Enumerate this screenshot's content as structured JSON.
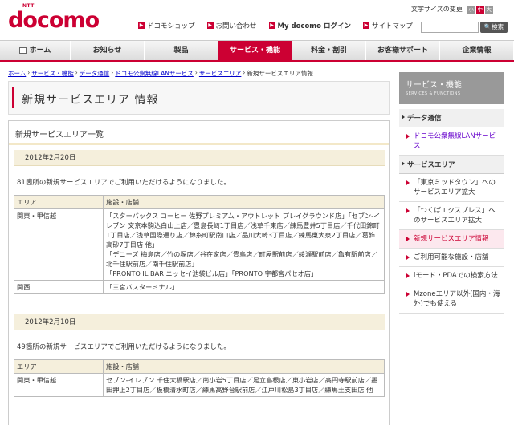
{
  "header": {
    "logo_ntt": "NTT",
    "logo_brand": "docomo",
    "links": [
      "ドコモショップ",
      "お問い合わせ",
      "My docomo ログイン",
      "サイトマップ"
    ],
    "fontsize_label": "文字サイズの変更",
    "fontsize_options": [
      "小",
      "中",
      "大"
    ],
    "search_button": "検索"
  },
  "gnav": [
    "ホーム",
    "お知らせ",
    "製品",
    "サービス・機能",
    "料金・割引",
    "お客様サポート",
    "企業情報"
  ],
  "breadcrumb": {
    "items": [
      "ホーム",
      "サービス・機能",
      "データ通信",
      "ドコモ公衆無線LANサービス",
      "サービスエリア"
    ],
    "current": "新規サービスエリア情報"
  },
  "page_title": "新規サービスエリア 情報",
  "main": {
    "heading": "新規サービスエリア一覧",
    "sections": [
      {
        "date": "2012年2月20日",
        "intro": "81箇所の新規サービスエリアでご利用いただけるようになりました。",
        "col_area": "エリア",
        "col_shops": "施設・店舗",
        "rows": [
          {
            "area": "関東・甲信越",
            "shops": [
              "「スターバックス コーヒー 佐野プレミアム・アウトレット プレイグラウンド店」「セブン-イレブン 文京本駒込白山上店／豊島長崎1丁目店／浅草千束店／練馬豊井5丁目店／千代田錦町1丁目店／浅草国際通り店／錦糸町駅南口店／品川大崎3丁目店／練馬東大泉2丁目店／葛飾高砂7丁目店 他」",
              "「デニーズ 梅島店／竹の塚店／谷在家店／豊島店／町屋駅前店／綾瀬駅前店／亀有駅前店／北千住駅前店／南千住駅前店」",
              "「PRONTO IL BAR ニッセイ池袋ビル店」「PRONTO 宇都宮パセオ店」"
            ]
          },
          {
            "area": "関西",
            "shops": [
              "「三宮バスターミナル」"
            ]
          }
        ]
      },
      {
        "date": "2012年2月10日",
        "intro": "49箇所の新規サービスエリアでご利用いただけるようになりました。",
        "col_area": "エリア",
        "col_shops": "施設・店舗",
        "rows": [
          {
            "area": "関東・甲信越",
            "shops": [
              "セブン-イレブン 千住大橋駅店／南小岩5丁目店／足立島根店／東小岩店／高円寺駅前店／墨田押上2丁目店／板橋清水町店／練馬高野台駅前店／江戸川松島3丁目店／練馬土支田店 他"
            ]
          }
        ]
      }
    ]
  },
  "sidebar": {
    "title": "サービス・機能",
    "subtitle": "SERVICES & FUNCTIONS",
    "sec_data": "データ通信",
    "item_lan": "ドコモ公衆無線LANサービス",
    "sec_area": "サービスエリア",
    "items": [
      "「東京ミッドタウン」へのサービスエリア拡大",
      "「つくばエクスプレス」へのサービスエリア拡大",
      "新規サービスエリア情報",
      "ご利用可能な施設・店舗",
      "iモード・PDAでの検索方法",
      "Mzoneエリア以外(国内・海外)でも使える"
    ]
  }
}
